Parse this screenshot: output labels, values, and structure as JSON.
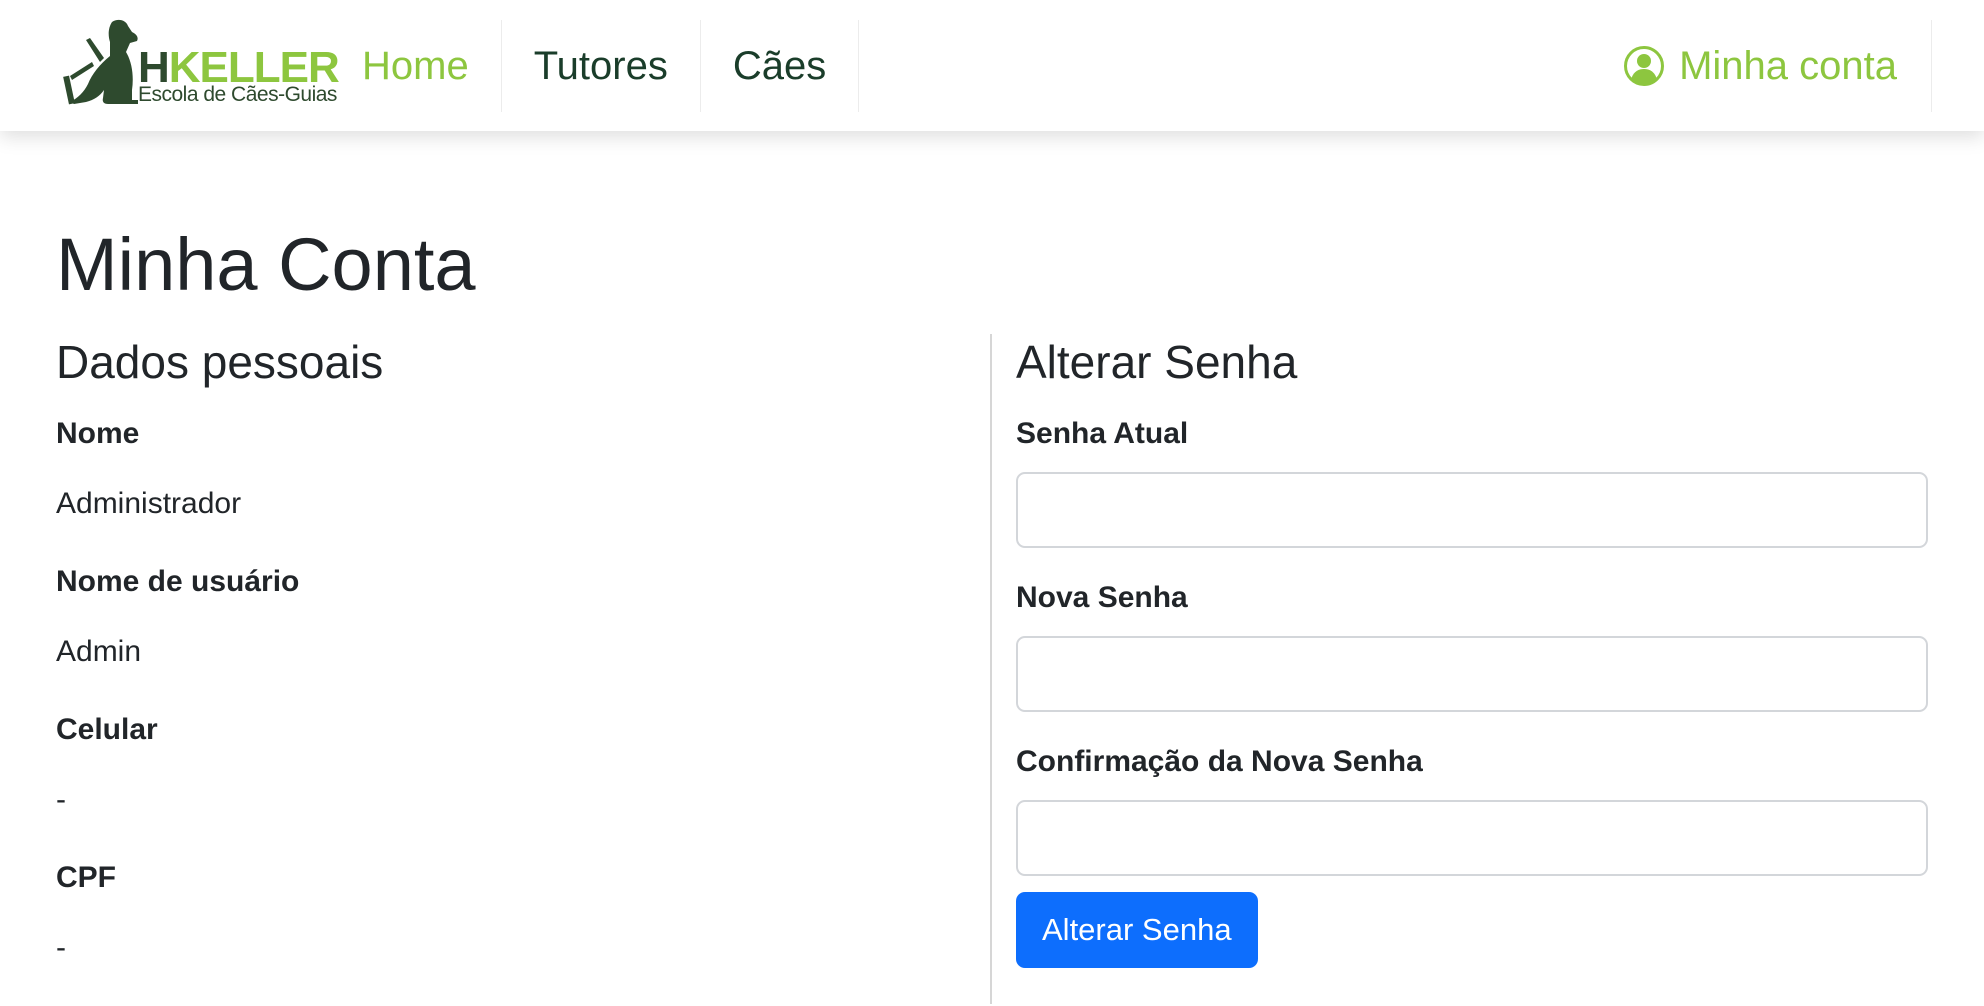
{
  "brand": {
    "name_first": "H",
    "name_rest": "KELLER",
    "tagline": "Escola de Cães-Guias",
    "logo_icon": "guide-dog-icon"
  },
  "nav": {
    "items": [
      {
        "label": "Home",
        "active": true
      },
      {
        "label": "Tutores",
        "active": false
      },
      {
        "label": "Cães",
        "active": false
      }
    ],
    "account_label": "Minha conta",
    "account_icon": "user-circle-icon"
  },
  "page": {
    "title": "Minha Conta"
  },
  "personal": {
    "heading": "Dados pessoais",
    "fields": [
      {
        "label": "Nome",
        "value": "Administrador"
      },
      {
        "label": "Nome de usuário",
        "value": "Admin"
      },
      {
        "label": "Celular",
        "value": "-"
      },
      {
        "label": "CPF",
        "value": "-"
      }
    ]
  },
  "password": {
    "heading": "Alterar Senha",
    "current_label": "Senha Atual",
    "current_value": "",
    "new_label": "Nova Senha",
    "new_value": "",
    "confirm_label": "Confirmação da Nova Senha",
    "confirm_value": "",
    "submit_label": "Alterar Senha"
  },
  "colors": {
    "brand_green": "#8dc63f",
    "dark_green": "#1a3d2a",
    "primary_button": "#0d6efd"
  }
}
